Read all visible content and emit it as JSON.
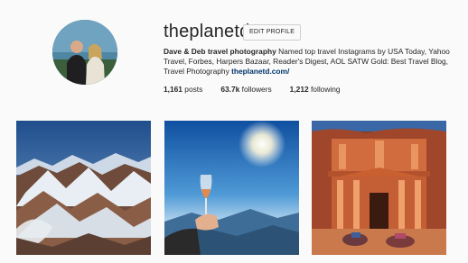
{
  "profile": {
    "username": "theplanetd",
    "edit_button_label": "EDIT PROFILE",
    "full_name": "Dave & Deb travel photography",
    "bio_text": "Named top travel Instagrams by USA Today, Yahoo Travel, Forbes, Harpers Bazaar, Reader's Digest, AOL SATW Gold: Best Travel Blog, Travel Photography",
    "website": "theplanetd.com/"
  },
  "stats": {
    "posts_count": "1,161",
    "posts_label": "posts",
    "followers_count": "63.7k",
    "followers_label": "followers",
    "following_count": "1,212",
    "following_label": "following"
  },
  "colors": {
    "background": "#fafafa",
    "text": "#262626",
    "link": "#003569"
  },
  "posts": [
    {
      "subject": "snowy mountain range aerial photo"
    },
    {
      "subject": "hand holding wine glass against sunset sky"
    },
    {
      "subject": "Petra Treasury with camels"
    }
  ]
}
